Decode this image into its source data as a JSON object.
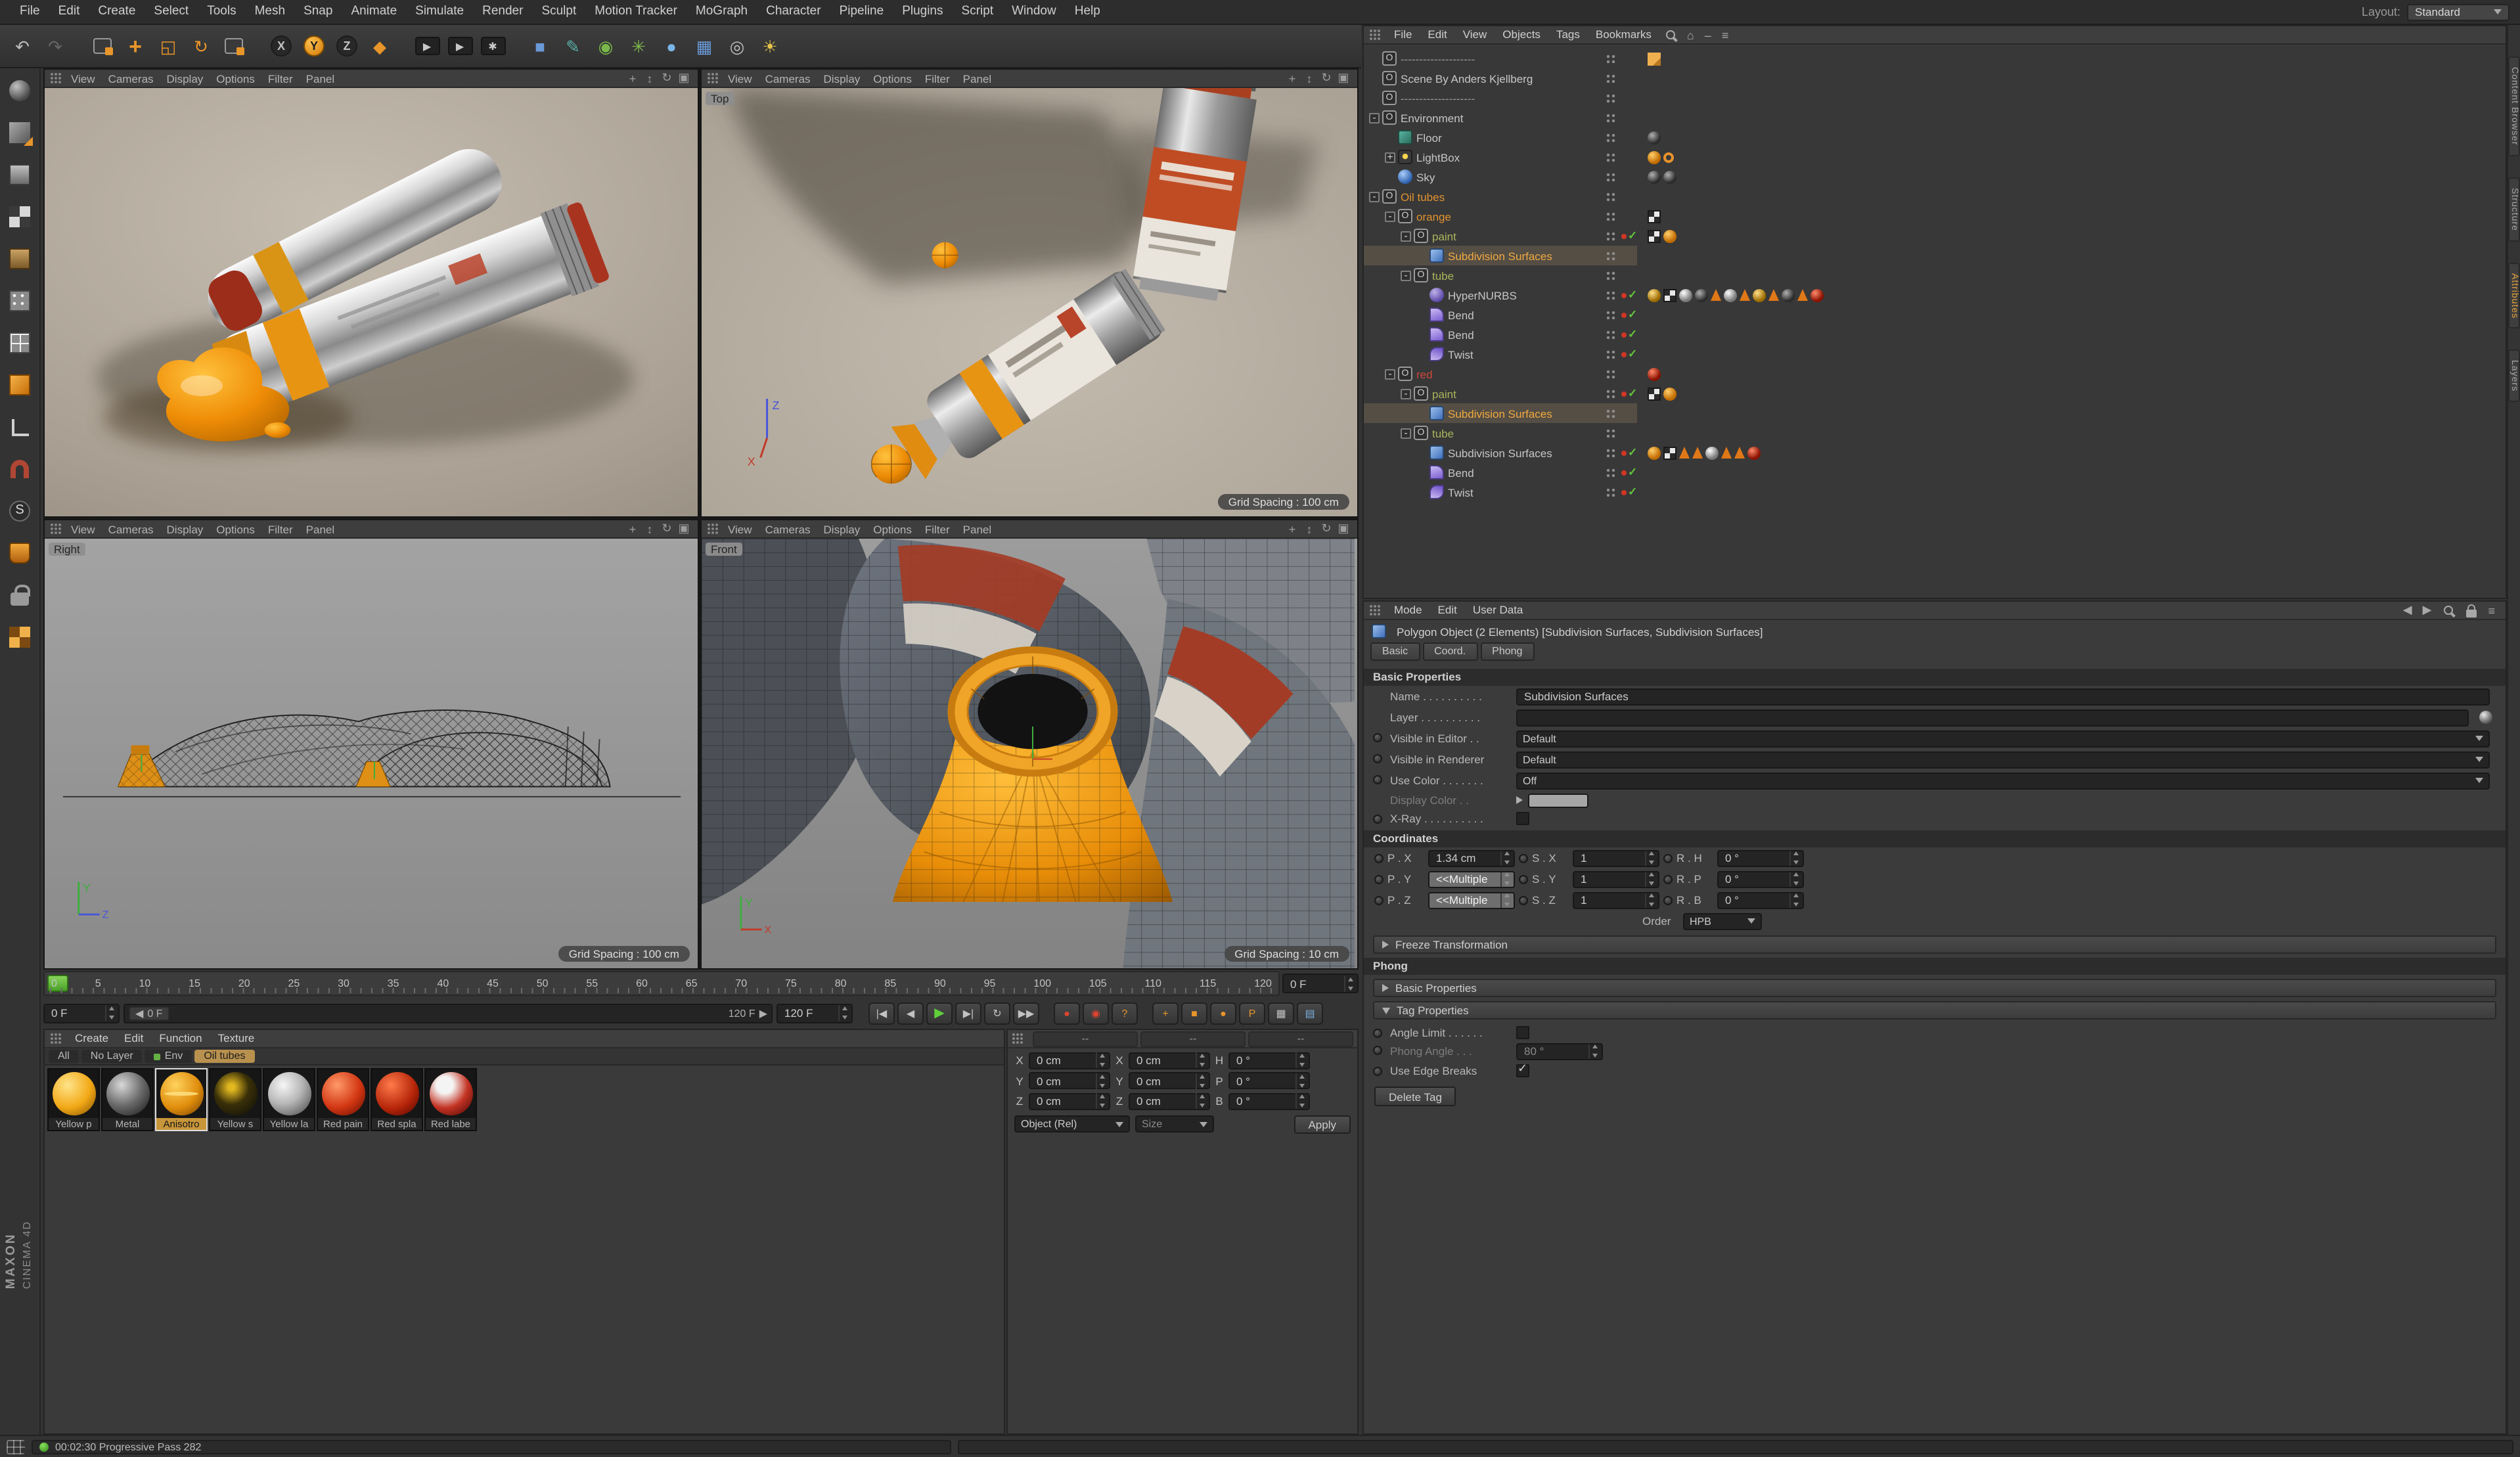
{
  "menu_bar": {
    "items": [
      "File",
      "Edit",
      "Create",
      "Select",
      "Tools",
      "Mesh",
      "Snap",
      "Animate",
      "Simulate",
      "Render",
      "Sculpt",
      "Motion Tracker",
      "MoGraph",
      "Character",
      "Pipeline",
      "Plugins",
      "Script",
      "Window",
      "Help"
    ],
    "layout_label": "Layout:",
    "layout_value": "Standard"
  },
  "toolbar": {
    "buttons": [
      {
        "name": "undo-button",
        "g": "↶",
        "cls": "g"
      },
      {
        "name": "redo-button",
        "g": "↷",
        "cls": "g dim"
      },
      {
        "name": "live-selection-tool",
        "g": "",
        "cls": "selbox mgl"
      },
      {
        "name": "move-tool",
        "g": "+",
        "cls": "o big"
      },
      {
        "name": "scale-tool",
        "g": "◱",
        "cls": "o"
      },
      {
        "name": "rotate-tool",
        "g": "↻",
        "cls": "o"
      },
      {
        "name": "last-tool-button",
        "g": "",
        "cls": "selbox"
      },
      {
        "name": "lock-x-axis-button",
        "g": "X",
        "cls": "axis mgl"
      },
      {
        "name": "lock-y-axis-button",
        "g": "Y",
        "cls": "axis on"
      },
      {
        "name": "lock-z-axis-button",
        "g": "Z",
        "cls": "axis"
      },
      {
        "name": "coordinate-system-button",
        "g": "◆",
        "cls": "o"
      },
      {
        "name": "render-view-button",
        "g": "▶",
        "cls": "ren mgl"
      },
      {
        "name": "render-picture-viewer-button",
        "g": "▶",
        "cls": "ren"
      },
      {
        "name": "render-settings-button",
        "g": "✱",
        "cls": "ren"
      },
      {
        "name": "add-cube-button",
        "g": "■",
        "cls": "blue mgl"
      },
      {
        "name": "add-spline-button",
        "g": "✎",
        "cls": "teal"
      },
      {
        "name": "add-subdivision-button",
        "g": "◉",
        "cls": "green"
      },
      {
        "name": "add-mograph-button",
        "g": "✳",
        "cls": "green"
      },
      {
        "name": "add-simulation-button",
        "g": "●",
        "cls": "lblue"
      },
      {
        "name": "add-environment-button",
        "g": "▦",
        "cls": "blue"
      },
      {
        "name": "add-camera-button",
        "g": "◎",
        "cls": "g"
      },
      {
        "name": "add-light-button",
        "g": "☀",
        "cls": "yellow"
      }
    ]
  },
  "left_toolbar": {
    "items": [
      {
        "name": "release-tool",
        "look": "lt-sphere"
      },
      {
        "name": "make-editable-button",
        "look": "lt-cube-conv"
      },
      {
        "name": "model-mode-button",
        "look": "lt-cube"
      },
      {
        "name": "texture-mode-button",
        "look": "lt-checker"
      },
      {
        "name": "workplane-mode-button",
        "look": "lt-plane"
      },
      {
        "name": "points-mode-button",
        "look": "lt-points"
      },
      {
        "name": "edges-mode-button",
        "look": "lt-edges"
      },
      {
        "name": "polygons-mode-button",
        "look": "lt-poly"
      },
      {
        "name": "enable-axis-button",
        "look": "lt-axis"
      },
      {
        "name": "snap-toggle-button",
        "look": "lt-magnet"
      },
      {
        "name": "snap-settings-button",
        "look": "lt-snap"
      },
      {
        "name": "paint-setup-button",
        "look": "lt-paint"
      },
      {
        "name": "texture-lock-button",
        "look": "lt-lock"
      },
      {
        "name": "uv-mode-button",
        "look": "lt-uv"
      }
    ]
  },
  "viewports": {
    "menus": [
      "View",
      "Cameras",
      "Display",
      "Options",
      "Filter",
      "Panel"
    ],
    "icons": {
      "pan": "+",
      "zoom": "↕",
      "rotate": "↻",
      "max": "▣"
    },
    "perspective": {
      "label": "",
      "grid": ""
    },
    "top": {
      "label": "Top",
      "grid": "Grid Spacing : 100 cm"
    },
    "right": {
      "label": "Right",
      "grid": "Grid Spacing : 100 cm"
    },
    "front": {
      "label": "Front",
      "grid": "Grid Spacing : 10 cm"
    }
  },
  "timeline": {
    "ticks": [
      "0",
      "5",
      "10",
      "15",
      "20",
      "25",
      "30",
      "35",
      "40",
      "45",
      "50",
      "55",
      "60",
      "65",
      "70",
      "75",
      "80",
      "85",
      "90",
      "95",
      "100",
      "105",
      "110",
      "115",
      "120"
    ],
    "end_box": "0 F"
  },
  "transport": {
    "current": "0 F",
    "slider_start_icon": "◀",
    "slider_start": "0 F",
    "slider_end": "120 F",
    "slider_end_icon": "▶",
    "end": "120 F",
    "buttons": [
      {
        "name": "goto-start-button",
        "g": "|◀",
        "cls": "mgl"
      },
      {
        "name": "prev-frame-button",
        "g": "◀",
        "cls": ""
      },
      {
        "name": "play-button",
        "g": "▶",
        "cls": "play"
      },
      {
        "name": "next-frame-button",
        "g": "▶|",
        "cls": ""
      },
      {
        "name": "loop-button",
        "g": "↻",
        "cls": ""
      },
      {
        "name": "goto-end-button",
        "g": "▶▶",
        "cls": ""
      },
      {
        "name": "record-keyframe-button",
        "g": "●",
        "cls": "red mgl"
      },
      {
        "name": "autokeying-button",
        "g": "◉",
        "cls": "red"
      },
      {
        "name": "keyframe-options-button",
        "g": "?",
        "cls": "orange"
      },
      {
        "name": "record-position-button",
        "g": "+",
        "cls": "orange mgl"
      },
      {
        "name": "record-scale-button",
        "g": "■",
        "cls": "orange"
      },
      {
        "name": "record-rotation-button",
        "g": "●",
        "cls": "orange"
      },
      {
        "name": "record-parameter-button",
        "g": "P",
        "cls": "orange"
      },
      {
        "name": "keyframe-selection-button",
        "g": "▦",
        "cls": ""
      },
      {
        "name": "timeline-window-button",
        "g": "▤",
        "cls": "blue"
      }
    ]
  },
  "material_manager": {
    "menus": [
      "Create",
      "Edit",
      "Function",
      "Texture"
    ],
    "tabs": [
      {
        "label": "All",
        "cls": ""
      },
      {
        "label": "No Layer",
        "cls": ""
      },
      {
        "label": "Env",
        "cls": "env"
      },
      {
        "label": "Oil tubes",
        "cls": "on"
      }
    ],
    "materials": [
      {
        "label": "Yellow p",
        "look": "m-yellow",
        "sel": ""
      },
      {
        "label": "Metal",
        "look": "m-metal",
        "sel": ""
      },
      {
        "label": "Anisotro",
        "look": "m-aniso",
        "sel": "on"
      },
      {
        "label": "Yellow s",
        "look": "m-ys",
        "sel": ""
      },
      {
        "label": "Yellow la",
        "look": "m-yl",
        "sel": ""
      },
      {
        "label": "Red pain",
        "look": "m-red1",
        "sel": ""
      },
      {
        "label": "Red spla",
        "look": "m-red2",
        "sel": ""
      },
      {
        "label": "Red labe",
        "look": "m-red3",
        "sel": ""
      }
    ]
  },
  "coord_manager": {
    "headers": [
      "--",
      "--",
      "--"
    ],
    "rows": [
      {
        "pa": "X",
        "pv": "0 cm",
        "sa": "X",
        "sv": "0 cm",
        "ra": "H",
        "rv": "0 °"
      },
      {
        "pa": "Y",
        "pv": "0 cm",
        "sa": "Y",
        "sv": "0 cm",
        "ra": "P",
        "rv": "0 °"
      },
      {
        "pa": "Z",
        "pv": "0 cm",
        "sa": "Z",
        "sv": "0 cm",
        "ra": "B",
        "rv": "0 °"
      }
    ],
    "mode": "Object (Rel)",
    "size_mode": "Size",
    "apply": "Apply"
  },
  "object_manager": {
    "menus": [
      "File",
      "Edit",
      "View",
      "Objects",
      "Tags",
      "Bookmarks"
    ],
    "icons": {
      "home": "⌂",
      "min": "–",
      "menu": "≡"
    },
    "tree": [
      {
        "ind": "0px",
        "exp": "",
        "icon": "ic-null",
        "name": "--------------------",
        "ncls": "dim",
        "tags": [
          "tg-note"
        ],
        "state": ""
      },
      {
        "ind": "0px",
        "exp": "",
        "icon": "ic-null",
        "name": "Scene By Anders Kjellberg",
        "ncls": "",
        "tags": [],
        "state": ""
      },
      {
        "ind": "0px",
        "exp": "",
        "icon": "ic-null",
        "name": "--------------------",
        "ncls": "dim",
        "tags": [],
        "state": ""
      },
      {
        "ind": "0px",
        "exp": "-",
        "icon": "ic-null",
        "name": "Environment",
        "ncls": "",
        "tags": [],
        "state": ""
      },
      {
        "ind": "12px",
        "exp": "",
        "icon": "ic-floor",
        "name": "Floor",
        "ncls": "",
        "tags": [
          "tg-mat-dark"
        ],
        "state": ""
      },
      {
        "ind": "12px",
        "exp": "+",
        "icon": "ic-light",
        "name": "LightBox",
        "ncls": "",
        "tags": [
          "tg-mat-orange",
          "tg-target"
        ],
        "state": ""
      },
      {
        "ind": "12px",
        "exp": "",
        "icon": "ic-sky",
        "name": "Sky",
        "ncls": "",
        "tags": [
          "tg-mat-dark",
          "tg-mat-dark"
        ],
        "state": ""
      },
      {
        "ind": "0px",
        "exp": "-",
        "icon": "ic-null",
        "name": "Oil tubes",
        "ncls": "org",
        "tags": [],
        "state": ""
      },
      {
        "ind": "12px",
        "exp": "-",
        "icon": "ic-null",
        "name": "orange",
        "ncls": "org",
        "tags": [
          "tg-checker"
        ],
        "state": ""
      },
      {
        "ind": "24px",
        "exp": "-",
        "icon": "ic-null",
        "name": "paint",
        "ncls": "grn",
        "tags": [
          "tg-checker",
          "tg-mat-orange"
        ],
        "state": "rc"
      },
      {
        "ind": "36px",
        "exp": "",
        "icon": "ic-subdiv",
        "name": "Subdivision Surfaces",
        "ncls": "sel",
        "sel": "on",
        "tags": [],
        "state": ""
      },
      {
        "ind": "24px",
        "exp": "-",
        "icon": "ic-null",
        "name": "tube",
        "ncls": "grn",
        "tags": [],
        "state": ""
      },
      {
        "ind": "36px",
        "exp": "",
        "icon": "ic-hyper",
        "name": "HyperNURBS",
        "ncls": "",
        "tags": [
          "tg-mat-gold",
          "tg-checker",
          "tg-mat-silver",
          "tg-mat-dark",
          "tg-tri",
          "tg-mat-silver",
          "tg-tri",
          "tg-mat-gold",
          "tg-tri",
          "tg-mat-dark",
          "tg-tri",
          "tg-mat-red"
        ],
        "state": "rc"
      },
      {
        "ind": "36px",
        "exp": "",
        "icon": "ic-bend",
        "name": "Bend",
        "ncls": "",
        "tags": [],
        "state": "rc"
      },
      {
        "ind": "36px",
        "exp": "",
        "icon": "ic-bend",
        "name": "Bend",
        "ncls": "",
        "tags": [],
        "state": "rc"
      },
      {
        "ind": "36px",
        "exp": "",
        "icon": "ic-twist",
        "name": "Twist",
        "ncls": "",
        "tags": [],
        "state": "rc"
      },
      {
        "ind": "12px",
        "exp": "-",
        "icon": "ic-null",
        "name": "red",
        "ncls": "red",
        "tags": [
          "tg-mat-red"
        ],
        "state": ""
      },
      {
        "ind": "24px",
        "exp": "-",
        "icon": "ic-null",
        "name": "paint",
        "ncls": "grn",
        "tags": [
          "tg-checker",
          "tg-mat-orange"
        ],
        "state": "rc"
      },
      {
        "ind": "36px",
        "exp": "",
        "icon": "ic-subdiv",
        "name": "Subdivision Surfaces",
        "ncls": "sel",
        "sel": "on",
        "tags": [],
        "state": ""
      },
      {
        "ind": "24px",
        "exp": "-",
        "icon": "ic-null",
        "name": "tube",
        "ncls": "grn",
        "tags": [],
        "state": ""
      },
      {
        "ind": "36px",
        "exp": "",
        "icon": "ic-subdiv",
        "name": "Subdivision Surfaces",
        "ncls": "",
        "tags": [
          "tg-mat-orange",
          "tg-checker",
          "tg-tri",
          "tg-tri",
          "tg-mat-silver",
          "tg-tri",
          "tg-tri",
          "tg-mat-red"
        ],
        "state": "rc"
      },
      {
        "ind": "36px",
        "exp": "",
        "icon": "ic-bend",
        "name": "Bend",
        "ncls": "",
        "tags": [],
        "state": "rc"
      },
      {
        "ind": "36px",
        "exp": "",
        "icon": "ic-twist",
        "name": "Twist",
        "ncls": "",
        "tags": [],
        "state": "rc"
      }
    ]
  },
  "attributes": {
    "menus": [
      "Mode",
      "Edit",
      "User Data"
    ],
    "icons": {
      "back": "◀",
      "fwd": "▶",
      "menu": "≡"
    },
    "title": "Polygon Object (2 Elements) [Subdivision Surfaces, Subdivision Surfaces]",
    "tabs": [
      "Basic",
      "Coord.",
      "Phong"
    ],
    "sections": {
      "basic": "Basic Properties",
      "coordinates": "Coordinates",
      "freeze": "Freeze Transformation",
      "phong": "Phong",
      "basic2": "Basic Properties",
      "tag": "Tag Properties"
    },
    "basic": {
      "name_label": "Name . . . . . . . . . .",
      "name_value": "Subdivision Surfaces",
      "layer_label": "Layer . . . . . . . . . .",
      "layer_value": "",
      "vis_editor_label": "Visible in Editor . .",
      "vis_editor_value": "Default",
      "vis_render_label": "Visible in Renderer",
      "vis_render_value": "Default",
      "use_color_label": "Use Color . . . . . . .",
      "use_color_value": "Off",
      "display_color_label": "Display Color . .",
      "xray_label": "X-Ray . . . . . . . . . ."
    },
    "coords": {
      "px_label": "P . X",
      "px_value": "1.34 cm",
      "py_label": "P . Y",
      "py_value": "<<Multiple",
      "pz_label": "P . Z",
      "pz_value": "<<Multiple",
      "sx_label": "S . X",
      "sx_value": "1",
      "sy_label": "S . Y",
      "sy_value": "1",
      "sz_label": "S . Z",
      "sz_value": "1",
      "rh_label": "R . H",
      "rh_value": "0 °",
      "rp_label": "R . P",
      "rp_value": "0 °",
      "rb_label": "R . B",
      "rb_value": "0 °",
      "order_label": "Order",
      "order_value": "HPB"
    },
    "tag": {
      "angle_label": "Angle Limit . . . . . .",
      "phong_angle_label": "Phong Angle . . .",
      "phong_angle_value": "80 °",
      "edge_label": "Use Edge Breaks"
    },
    "delete_button": "Delete Tag"
  },
  "right_tabs": [
    {
      "label": "Content Browser",
      "cls": ""
    },
    {
      "label": "Structure",
      "cls": ""
    },
    {
      "label": "Attributes",
      "cls": "on"
    },
    {
      "label": "Layers",
      "cls": ""
    }
  ],
  "status_bar": {
    "time_text": "00:02:30 Progressive Pass 282"
  },
  "branding": {
    "maxon": "MAXON",
    "cinema": "CINEMA 4D"
  }
}
